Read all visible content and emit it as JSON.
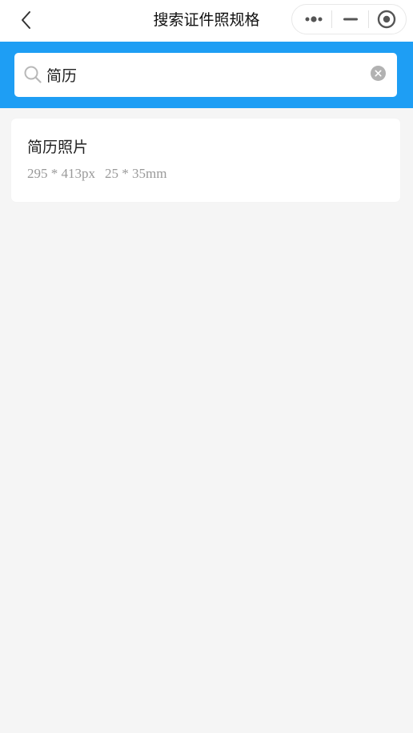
{
  "header": {
    "title": "搜索证件照规格",
    "back_icon": "chevron-left-icon",
    "capsule": {
      "more_icon": "more-dots-icon",
      "minimize_icon": "minimize-icon",
      "close_icon": "target-circle-icon"
    }
  },
  "search": {
    "value": "简历",
    "placeholder": "",
    "icon": "search-icon",
    "clear_icon": "clear-icon"
  },
  "results": [
    {
      "name": "简历照片",
      "pixels": "295 * 413px",
      "size_mm": "25 * 35mm"
    }
  ],
  "colors": {
    "accent": "#1e9ef4",
    "background": "#f5f5f5",
    "card": "#ffffff",
    "secondary_text": "#999999"
  }
}
